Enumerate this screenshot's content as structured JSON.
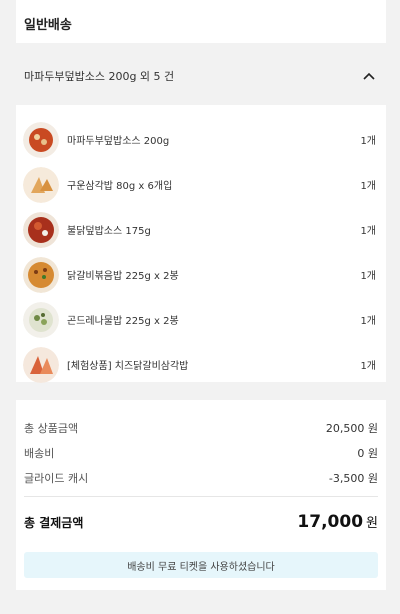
{
  "section": {
    "title": "일반배송"
  },
  "summary": {
    "text": "마파두부덮밥소스 200g 외 5 건"
  },
  "items": [
    {
      "name": "마파두부덮밥소스 200g",
      "qty": "1개"
    },
    {
      "name": "구운삼각밥 80g x 6개입",
      "qty": "1개"
    },
    {
      "name": "불닭덮밥소스 175g",
      "qty": "1개"
    },
    {
      "name": "닭갈비볶음밥 225g x 2봉",
      "qty": "1개"
    },
    {
      "name": "곤드레나물밥 225g x 2봉",
      "qty": "1개"
    },
    {
      "name": "[체험상품] 치즈닭갈비삼각밥",
      "qty": "1개"
    }
  ],
  "totals": {
    "product_label": "총 상품금액",
    "product_value": "20,500 원",
    "shipping_label": "배송비",
    "shipping_value": "0 원",
    "cash_label": "글라이드 캐시",
    "cash_value": "-3,500 원",
    "grand_label": "총 결제금액",
    "grand_amount": "17,000",
    "grand_unit": "원"
  },
  "notice": {
    "text": "배송비 무료 티켓을 사용하셨습니다"
  }
}
